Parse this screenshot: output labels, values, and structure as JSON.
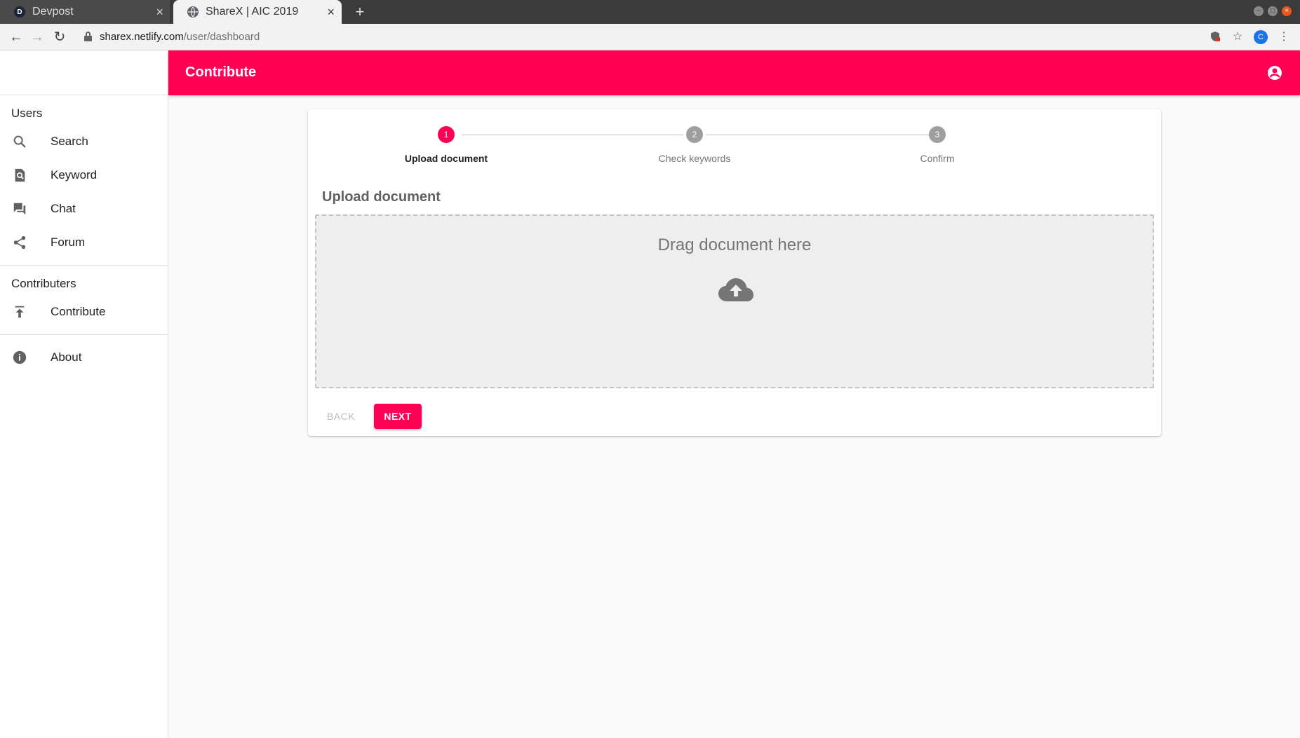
{
  "browser": {
    "tabs": [
      {
        "favicon": "D",
        "title": "Devpost",
        "active": false
      },
      {
        "favicon": "globe-icon",
        "title": "ShareX | AIC 2019",
        "active": true
      }
    ],
    "url_host": "sharex.netlify.com",
    "url_path": "/user/dashboard",
    "profile_initial": "C"
  },
  "sidebar": {
    "sections": [
      {
        "title": "Users",
        "items": [
          {
            "label": "Search",
            "icon": "search-icon"
          },
          {
            "label": "Keyword",
            "icon": "find-in-page-icon"
          },
          {
            "label": "Chat",
            "icon": "forum-chat-icon"
          },
          {
            "label": "Forum",
            "icon": "share-icon"
          }
        ]
      },
      {
        "title": "Contributers",
        "items": [
          {
            "label": "Contribute",
            "icon": "publish-icon"
          }
        ]
      },
      {
        "title": "",
        "items": [
          {
            "label": "About",
            "icon": "info-icon"
          }
        ]
      }
    ]
  },
  "appbar": {
    "title": "Contribute",
    "account_icon": "account-circle-icon"
  },
  "stepper": {
    "steps": [
      {
        "number": "1",
        "label": "Upload document",
        "active": true
      },
      {
        "number": "2",
        "label": "Check keywords",
        "active": false
      },
      {
        "number": "3",
        "label": "Confirm",
        "active": false
      }
    ]
  },
  "upload": {
    "heading": "Upload document",
    "drop_text": "Drag document here",
    "icon": "cloud-upload-icon"
  },
  "actions": {
    "back_label": "BACK",
    "next_label": "NEXT"
  },
  "colors": {
    "accent": "#ff0055",
    "background": "#fafafa",
    "dropzone": "#eeeeee"
  }
}
